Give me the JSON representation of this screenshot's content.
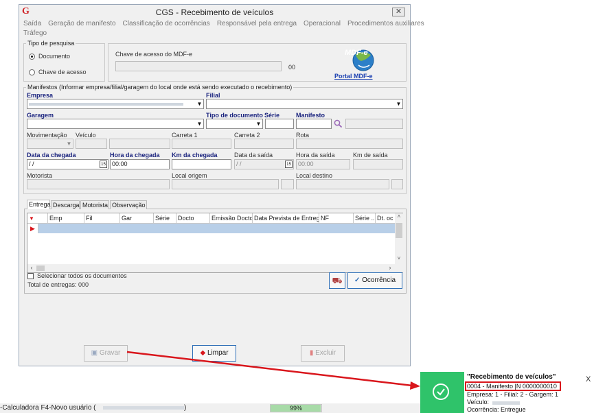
{
  "window": {
    "title": "CGS - Recebimento de veículos",
    "close_glyph": "✕",
    "logo_letter": "G"
  },
  "menu": [
    "Saída",
    "Geração de manifesto",
    "Classificação de ocorrências",
    "Responsável pela entrega",
    "Operacional",
    "Procedimentos auxiliares",
    "Tráfego"
  ],
  "search": {
    "legend": "Tipo de pesquisa",
    "option_documento": "Documento",
    "option_chave": "Chave de acesso",
    "chave_label": "Chave de acesso do MDF-e",
    "chave_count": "00",
    "portal_link": "Portal MDF-e",
    "portal_logo": "MDF-e"
  },
  "manifestos": {
    "legend": "Manifestos (Informar empresa/filial/garagem do local onde está sendo executado o recebimento)",
    "empresa_label": "Empresa",
    "filial_label": "Filial",
    "garagem_label": "Garagem",
    "tipo_doc_label": "Tipo de documento",
    "serie_label": "Série",
    "manifesto_label": "Manifesto",
    "movimentacao_label": "Movimentação",
    "veiculo_label": "Veículo",
    "carreta1_label": "Carreta 1",
    "carreta2_label": "Carreta 2",
    "rota_label": "Rota",
    "data_chegada_label": "Data da chegada",
    "data_chegada_value": " /  /",
    "hora_chegada_label": "Hora da chegada",
    "hora_chegada_value": "00:00",
    "km_chegada_label": "Km da chegada",
    "data_saida_label": "Data da saída",
    "data_saida_value": " /  /",
    "hora_saida_label": "Hora da saída",
    "hora_saida_value": "00:00",
    "km_saida_label": "Km de saída",
    "motorista_label": "Motorista",
    "local_origem_label": "Local origem",
    "local_destino_label": "Local destino"
  },
  "tabs": [
    "Entrega",
    "Descarga",
    "Motorista",
    "Observação"
  ],
  "grid": {
    "columns": [
      "Emp",
      "Fil",
      "Gar",
      "Série",
      "Docto",
      "Emissão Docto",
      "Data Prevista de Entrega",
      "NF",
      "Série ...",
      "Dt. oc"
    ]
  },
  "footer": {
    "select_all": "Selecionar todos os documentos",
    "total": "Total de entregas: 000",
    "ocorrencia_btn": "Ocorrência"
  },
  "actions": {
    "gravar": "Gravar",
    "limpar": "Limpar",
    "excluir": "Excluir"
  },
  "statusbar": {
    "left_text": "-Calculadora F4-Novo usuário (",
    "progress_text": "99%",
    "progress": 0.99
  },
  "toast": {
    "title": "\"Recebimento de veículos\"",
    "line1": "0004 - Manifesto |N 0000000010",
    "line2": "Empresa: 1 - Filial: 2 - Gargem: 1",
    "line3": "Veículo:",
    "line4": "Ocorrência: Entregue",
    "close": "X"
  },
  "colors": {
    "accent": "#2f6fb7",
    "label_blue": "#1a237e",
    "toast_green": "#2fc36a",
    "arrow_red": "#d9161c",
    "selection": "#b8cfe8"
  }
}
